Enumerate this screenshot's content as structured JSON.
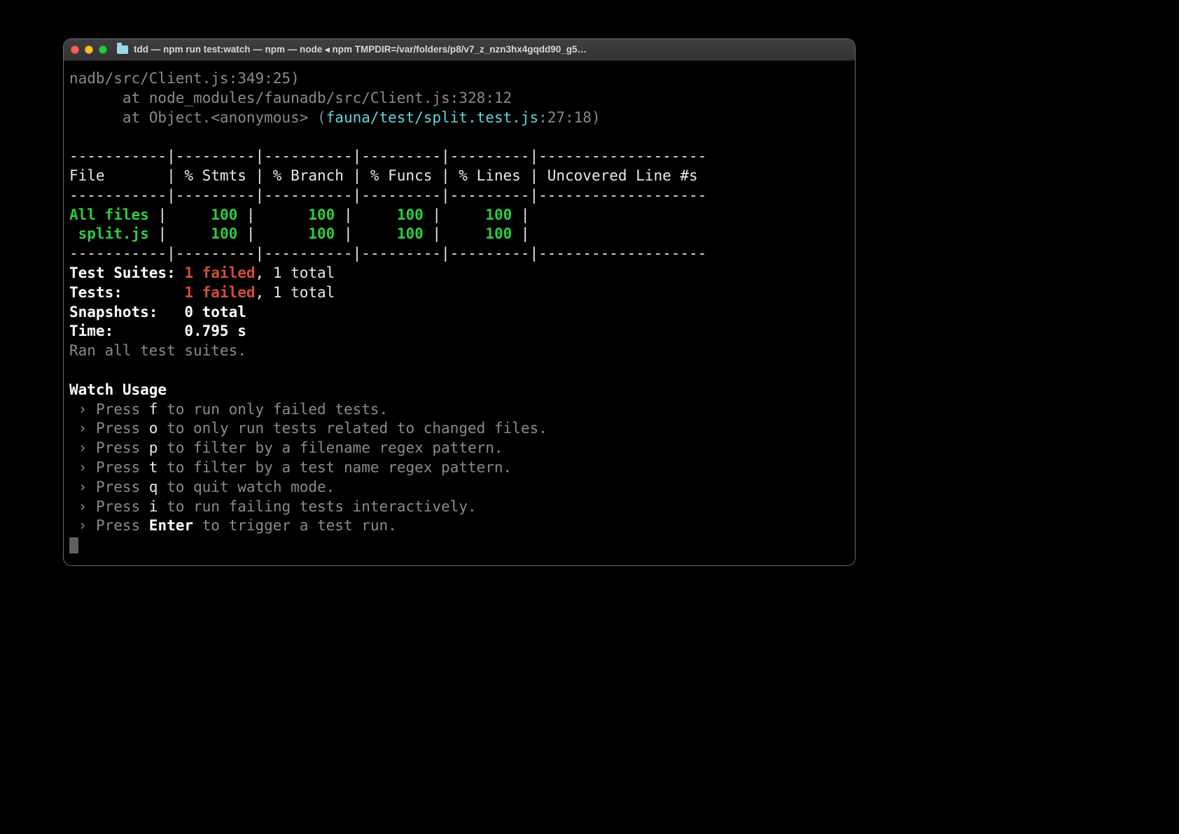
{
  "window": {
    "title": "tdd — npm run test:watch — npm — node ◂ npm TMPDIR=/var/folders/p8/v7_z_nzn3hx4gqdd90_g5…"
  },
  "stack": {
    "line1": "nadb/src/Client.js:349:25)",
    "line2_prefix": "      at node_modules/faunadb/src/Client.js:328:12",
    "line3_prefix": "      at Object.<anonymous> (",
    "line3_path": "fauna/test/split.test.js",
    "line3_suffix": ":27:18)"
  },
  "coverage": {
    "border_top": "-----------|---------|----------|---------|---------|-------------------",
    "header": "File       | % Stmts | % Branch | % Funcs | % Lines | Uncovered Line #s ",
    "border_mid": "-----------|---------|----------|---------|---------|-------------------",
    "border_bot": "-----------|---------|----------|---------|---------|-------------------",
    "rows": [
      {
        "label": "All files ",
        "stmts": "100",
        "branch": "100",
        "funcs": "100",
        "lines": "100",
        "uncov": ""
      },
      {
        "label": " split.js ",
        "stmts": "100",
        "branch": "100",
        "funcs": "100",
        "lines": "100",
        "uncov": ""
      }
    ]
  },
  "summary": {
    "suites_label": "Test Suites: ",
    "suites_fail": "1 failed",
    "suites_rest": ", 1 total",
    "tests_label": "Tests:       ",
    "tests_fail": "1 failed",
    "tests_rest": ", 1 total",
    "snapshots": "Snapshots:   0 total",
    "time": "Time:        0.795 s",
    "ran": "Ran all test suites."
  },
  "watch": {
    "title": "Watch Usage",
    "items": [
      {
        "key": "f",
        "desc": " to run only failed tests."
      },
      {
        "key": "o",
        "desc": " to only run tests related to changed files."
      },
      {
        "key": "p",
        "desc": " to filter by a filename regex pattern."
      },
      {
        "key": "t",
        "desc": " to filter by a test name regex pattern."
      },
      {
        "key": "q",
        "desc": " to quit watch mode."
      },
      {
        "key": "i",
        "desc": " to run failing tests interactively."
      },
      {
        "key": "Enter",
        "desc": " to trigger a test run."
      }
    ],
    "press": "Press "
  }
}
